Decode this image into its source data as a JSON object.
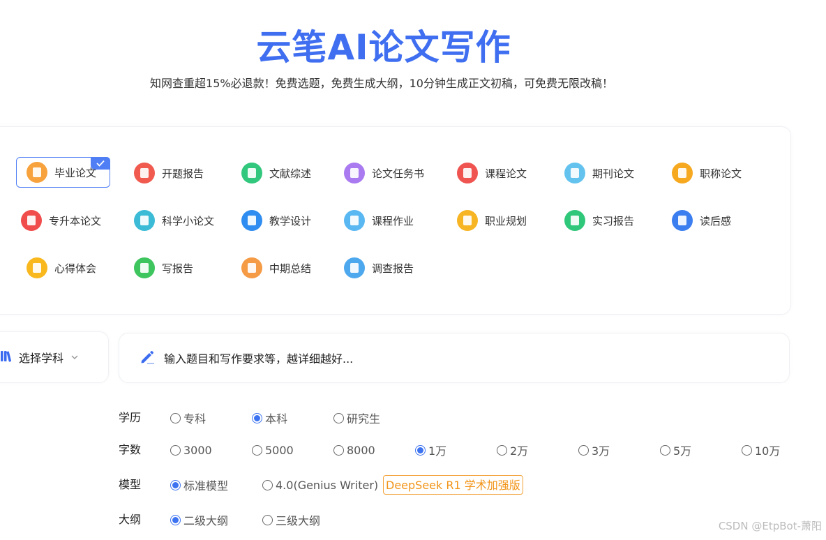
{
  "header": {
    "title": "云笔AI论文写作",
    "subtitle": "知网查重超15%必退款！免费选题，免费生成大纲，10分钟生成正文初稿，可免费无限改稿！"
  },
  "paper_types": [
    {
      "label": "毕业论文",
      "selected": true,
      "color": "#f7a23c"
    },
    {
      "label": "开题报告",
      "selected": false,
      "color": "#f05a4f"
    },
    {
      "label": "文献综述",
      "selected": false,
      "color": "#31c77c"
    },
    {
      "label": "论文任务书",
      "selected": false,
      "color": "#a97af0"
    },
    {
      "label": "课程论文",
      "selected": false,
      "color": "#ef5450"
    },
    {
      "label": "期刊论文",
      "selected": false,
      "color": "#63c3ee"
    },
    {
      "label": "职称论文",
      "selected": false,
      "color": "#f6a81f"
    },
    {
      "label": "专升本论文",
      "selected": false,
      "color": "#f04c4c"
    },
    {
      "label": "科学小论文",
      "selected": false,
      "color": "#3bbbd5"
    },
    {
      "label": "教学设计",
      "selected": false,
      "color": "#2f8cf0"
    },
    {
      "label": "课程作业",
      "selected": false,
      "color": "#59b7f2"
    },
    {
      "label": "职业规划",
      "selected": false,
      "color": "#f7b423"
    },
    {
      "label": "实习报告",
      "selected": false,
      "color": "#2fc77a"
    },
    {
      "label": "读后感",
      "selected": false,
      "color": "#3b7ef0"
    },
    {
      "label": "心得体会",
      "selected": false,
      "color": "#f8b81e"
    },
    {
      "label": "写报告",
      "selected": false,
      "color": "#3ec55e"
    },
    {
      "label": "中期总结",
      "selected": false,
      "color": "#f59a45"
    },
    {
      "label": "调查报告",
      "selected": false,
      "color": "#4ea8ee"
    }
  ],
  "subject": {
    "label": "选择学科",
    "icon": "books-icon"
  },
  "topic": {
    "placeholder": "输入题目和写作要求等，越详细越好...",
    "icon": "pencil-icon"
  },
  "options": {
    "education": {
      "label": "学历",
      "choices": [
        "专科",
        "本科",
        "研究生"
      ],
      "selected": "本科"
    },
    "words": {
      "label": "字数",
      "choices": [
        "3000",
        "5000",
        "8000",
        "1万",
        "2万",
        "3万",
        "5万",
        "10万"
      ],
      "selected": "1万"
    },
    "model": {
      "label": "模型",
      "choices": [
        "标准模型",
        "4.0(Genius Writer)"
      ],
      "selected": "标准模型",
      "badge": "DeepSeek R1 学术加强版"
    },
    "outline": {
      "label": "大纲",
      "choices": [
        "二级大纲",
        "三级大纲"
      ],
      "selected": "二级大纲"
    }
  },
  "watermark": "CSDN @EtpBot-萧阳",
  "accent_color": "#3f6ef0"
}
